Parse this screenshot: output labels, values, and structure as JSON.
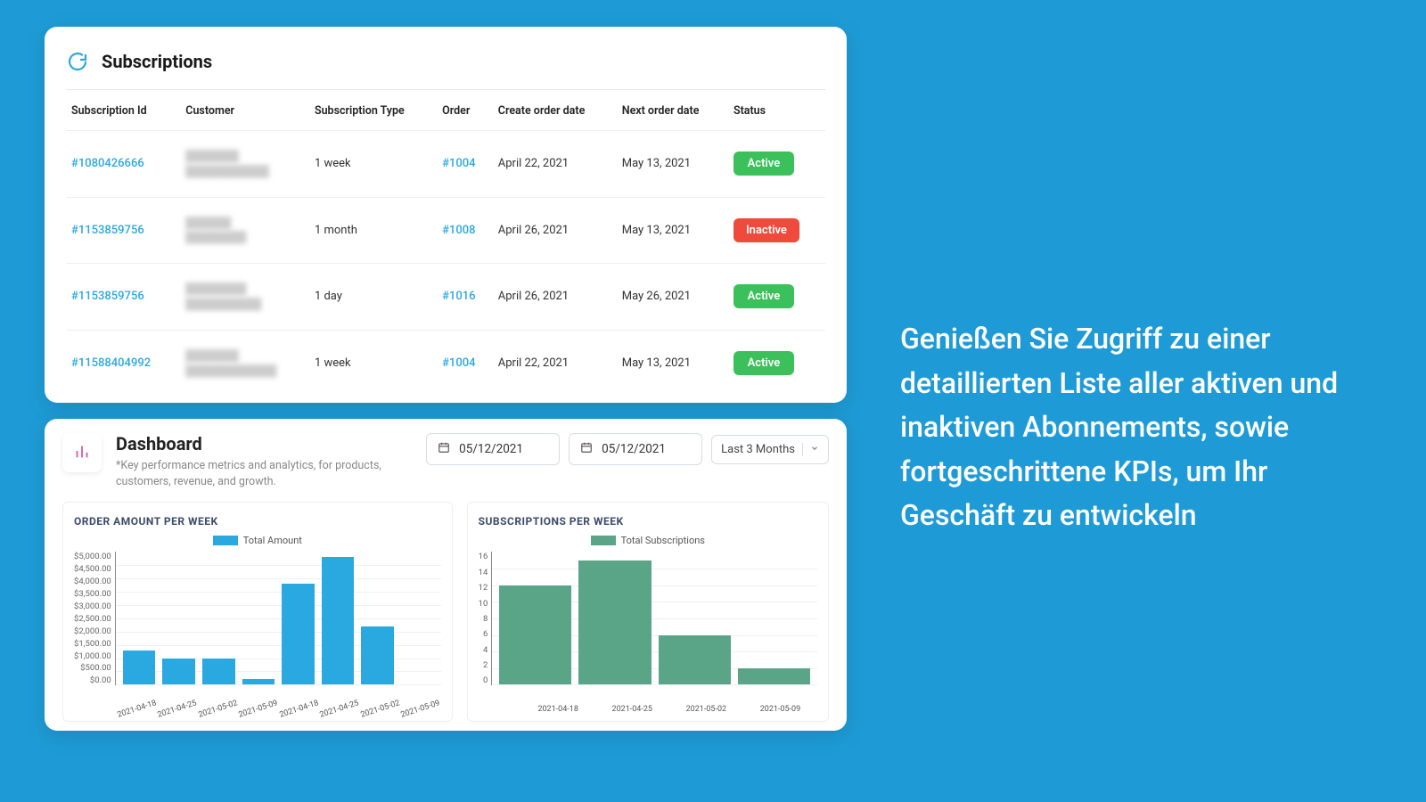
{
  "promo_text": "Genießen Sie Zugriff zu einer detaillierten Liste aller aktiven und inaktiven Abonnements, sowie fortgeschrittene KPIs, um Ihr Geschäft zu entwickeln",
  "subscriptions": {
    "title": "Subscriptions",
    "columns": {
      "id": "Subscription Id",
      "customer": "Customer",
      "type": "Subscription Type",
      "order": "Order",
      "create_date": "Create order date",
      "next_date": "Next order date",
      "status": "Status"
    },
    "rows": [
      {
        "id": "#1080426666",
        "customer_name": "███████",
        "customer_email": "███████████",
        "type": "1 week",
        "order": "#1004",
        "create_date": "April 22, 2021",
        "next_date": "May 13, 2021",
        "status": "Active"
      },
      {
        "id": "#1153859756",
        "customer_name": "██████",
        "customer_email": "████████",
        "type": "1 month",
        "order": "#1008",
        "create_date": "April 26, 2021",
        "next_date": "May 13, 2021",
        "status": "Inactive"
      },
      {
        "id": "#1153859756",
        "customer_name": "████████",
        "customer_email": "██████████",
        "type": "1 day",
        "order": "#1016",
        "create_date": "April 26, 2021",
        "next_date": "May 26, 2021",
        "status": "Active"
      },
      {
        "id": "#11588404992",
        "customer_name": "███████",
        "customer_email": "████████████",
        "type": "1 week",
        "order": "#1004",
        "create_date": "April 22, 2021",
        "next_date": "May 13, 2021",
        "status": "Active"
      }
    ]
  },
  "dashboard": {
    "title": "Dashboard",
    "subtitle": "*Key performance metrics and analytics, for products, customers, revenue, and growth.",
    "date_from": "05/12/2021",
    "date_to": "05/12/2021",
    "range_label": "Last 3 Months"
  },
  "chart_data": [
    {
      "type": "bar",
      "title": "ORDER AMOUNT PER WEEK",
      "legend": "Total Amount",
      "color": "#2aa8e0",
      "categories": [
        "2021-04-18",
        "2021-04-25",
        "2021-05-02",
        "2021-05-09",
        "2021-04-18",
        "2021-04-25",
        "2021-05-02",
        "2021-05-09"
      ],
      "values": [
        1300,
        1000,
        1000,
        200,
        3800,
        4800,
        2200,
        0
      ],
      "ylabel": "",
      "xlabel": "",
      "ylim": [
        0,
        5000
      ],
      "y_ticks": [
        "$5,000.00",
        "$4,500.00",
        "$4,000.00",
        "$3,500.00",
        "$3,000.00",
        "$2,500.00",
        "$2,000.00",
        "$1,500.00",
        "$1,000.00",
        "$500.00",
        "$0.00"
      ]
    },
    {
      "type": "bar",
      "title": "SUBSCRIPTIONS PER WEEK",
      "legend": "Total Subscriptions",
      "color": "#5aa588",
      "categories": [
        "2021-04-18",
        "2021-04-25",
        "2021-05-02",
        "2021-05-09"
      ],
      "values": [
        12,
        15,
        6,
        2
      ],
      "ylabel": "",
      "xlabel": "",
      "ylim": [
        0,
        16
      ],
      "y_ticks": [
        "16",
        "14",
        "12",
        "10",
        "8",
        "6",
        "4",
        "2",
        "0"
      ]
    }
  ]
}
